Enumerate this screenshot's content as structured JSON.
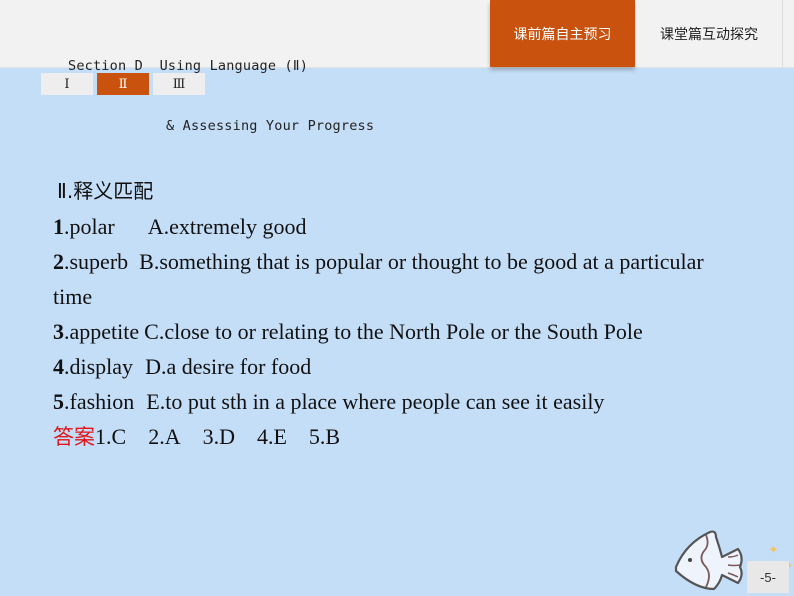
{
  "header": {
    "title_line1": "Section D  Using Language (Ⅱ)",
    "title_line2": "& Assessing Your Progress",
    "nav_tabs": [
      {
        "label": "课前篇自主预习",
        "active": true
      },
      {
        "label": "课堂篇互动探究",
        "active": false
      }
    ]
  },
  "subtabs": [
    {
      "label": "Ⅰ",
      "active": false
    },
    {
      "label": "Ⅱ",
      "active": true
    },
    {
      "label": "Ⅲ",
      "active": false
    }
  ],
  "exercise": {
    "heading": "Ⅱ.释义匹配",
    "items": [
      {
        "num": "1",
        "word": ".polar",
        "def": "A.extremely good"
      },
      {
        "num": "2",
        "word": ".superb",
        "def": "B.something that is popular or thought to be good at a particular time"
      },
      {
        "num": "3",
        "word": ".appetite",
        "def": "C.close to or relating to the North Pole or the South Pole"
      },
      {
        "num": "4",
        "word": ".display",
        "def": "D.a desire for food"
      },
      {
        "num": "5",
        "word": ".fashion",
        "def": "E.to put sth in a place where people can see it easily"
      }
    ],
    "answer_label": "答案",
    "answers": [
      "1.C",
      "2.A",
      "3.D",
      "4.E",
      "5.B"
    ]
  },
  "footer": {
    "page_number": "-5-",
    "decoration_icon": "fish-icon"
  },
  "colors": {
    "accent": "#c9520e",
    "background": "#c5def8",
    "answer_label": "#e0151c"
  }
}
